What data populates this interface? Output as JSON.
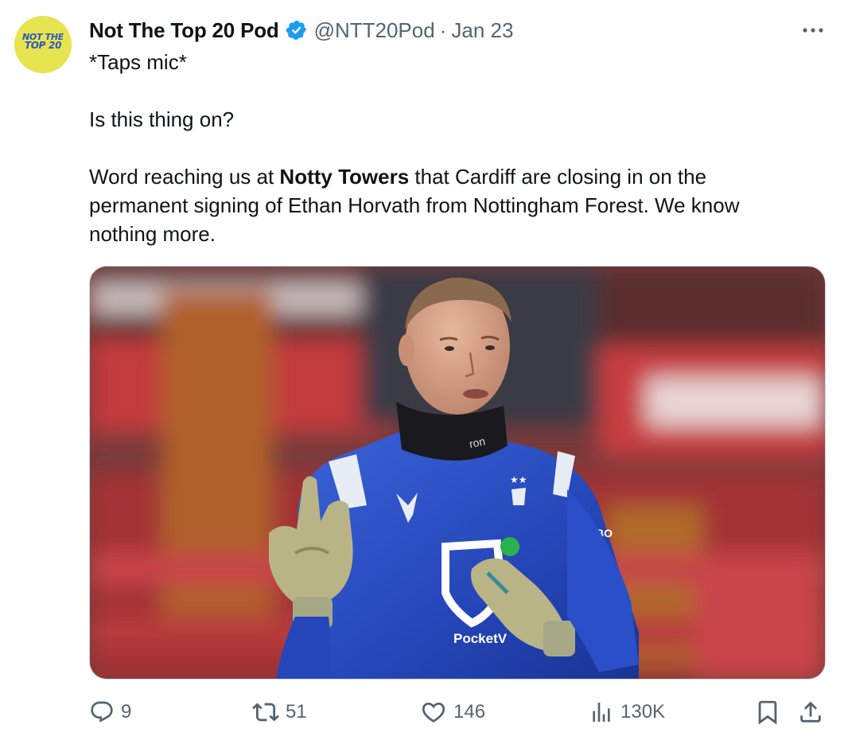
{
  "author": {
    "avatar_text_line1": "NOT THE",
    "avatar_text_line2": "TOP 20",
    "name": "Not The Top 20 Pod",
    "handle": "@NTT20Pod",
    "separator": "·",
    "date": "Jan 23",
    "verified": true
  },
  "tweet": {
    "line1": "*Taps mic*",
    "line2": "Is this thing on?",
    "line3_prefix": "Word reaching us at ",
    "line3_bold": "Notty Towers",
    "line3_suffix": " that Cardiff are closing in on the permanent signing of Ethan Horvath from Nottingham Forest. We know nothing more."
  },
  "media": {
    "kit_text_sponsor": "PocketV",
    "kit_text_collar": "ron",
    "kit_text_sleeve": "BO"
  },
  "actions": {
    "replies": "9",
    "reposts": "51",
    "likes": "146",
    "views": "130K"
  },
  "colors": {
    "text": "#0f1419",
    "secondary": "#536471",
    "verified_blue": "#1d9bf0",
    "avatar_bg": "#e6e44f",
    "kit_blue": "#2a4fc8"
  }
}
